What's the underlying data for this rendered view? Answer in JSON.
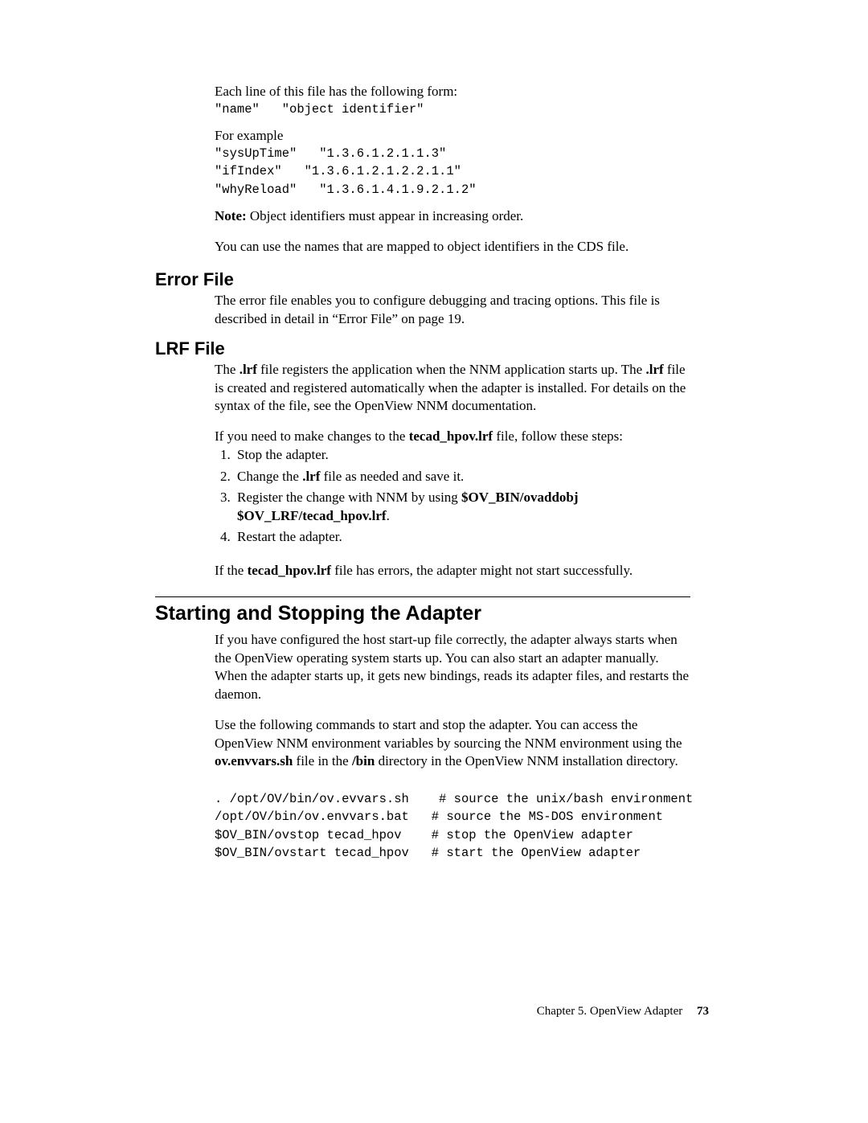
{
  "intro": {
    "line_form": "Each line of this file has the following form:",
    "form_code": "\"name\"   \"object identifier\"",
    "for_example": "For example",
    "example_code": "\"sysUpTime\"   \"1.3.6.1.2.1.1.3\"\n\"ifIndex\"   \"1.3.6.1.2.1.2.2.1.1\"\n\"whyReload\"   \"1.3.6.1.4.1.9.2.1.2\"",
    "note_label": "Note:",
    "note_text": " Object identifiers must appear in increasing order.",
    "use_names": "You can use the names that are mapped to object identifiers in the CDS file."
  },
  "error_file": {
    "heading": "Error File",
    "body": "The error file enables you to configure debugging and tracing options. This file is described in detail in “Error File” on page 19."
  },
  "lrf_file": {
    "heading": "LRF File",
    "p1_a": "The ",
    "p1_b": ".lrf",
    "p1_c": " file registers the application when the NNM application starts up. The ",
    "p1_d": ".lrf",
    "p1_e": " file is created and registered automatically when the adapter is installed. For details on the syntax of the file, see the OpenView NNM documentation.",
    "p2_a": "If you need to make changes to the ",
    "p2_b": "tecad_hpov.lrf",
    "p2_c": " file, follow these steps:",
    "li1": "Stop the adapter.",
    "li2_a": "Change the ",
    "li2_b": ".lrf",
    "li2_c": " file as needed and save it.",
    "li3_a": "Register the change with NNM by using ",
    "li3_b": "$OV_BIN/ovaddobj $OV_LRF/tecad_hpov.lrf",
    "li3_c": ".",
    "li4": "Restart the adapter.",
    "p3_a": "If the ",
    "p3_b": "tecad_hpov.lrf",
    "p3_c": " file has errors, the adapter might not start successfully."
  },
  "start_stop": {
    "heading": "Starting and Stopping the Adapter",
    "p1": "If you have configured the host start-up file correctly, the adapter always starts when the OpenView operating system starts up. You can also start an adapter manually. When the adapter starts up, it gets new bindings, reads its adapter files, and restarts the daemon.",
    "p2_a": "Use the following commands to start and stop the adapter. You can access the OpenView NNM environment variables by sourcing the NNM environment using the ",
    "p2_b": "ov.envvars.sh",
    "p2_c": " file in the ",
    "p2_d": "/bin",
    "p2_e": " directory in the OpenView NNM installation directory.",
    "code": ". /opt/OV/bin/ov.evvars.sh    # source the unix/bash environment\n/opt/OV/bin/ov.envvars.bat   # source the MS-DOS environment\n$OV_BIN/ovstop tecad_hpov    # stop the OpenView adapter\n$OV_BIN/ovstart tecad_hpov   # start the OpenView adapter"
  },
  "footer": {
    "chapter": "Chapter 5. OpenView Adapter",
    "page": "73"
  }
}
